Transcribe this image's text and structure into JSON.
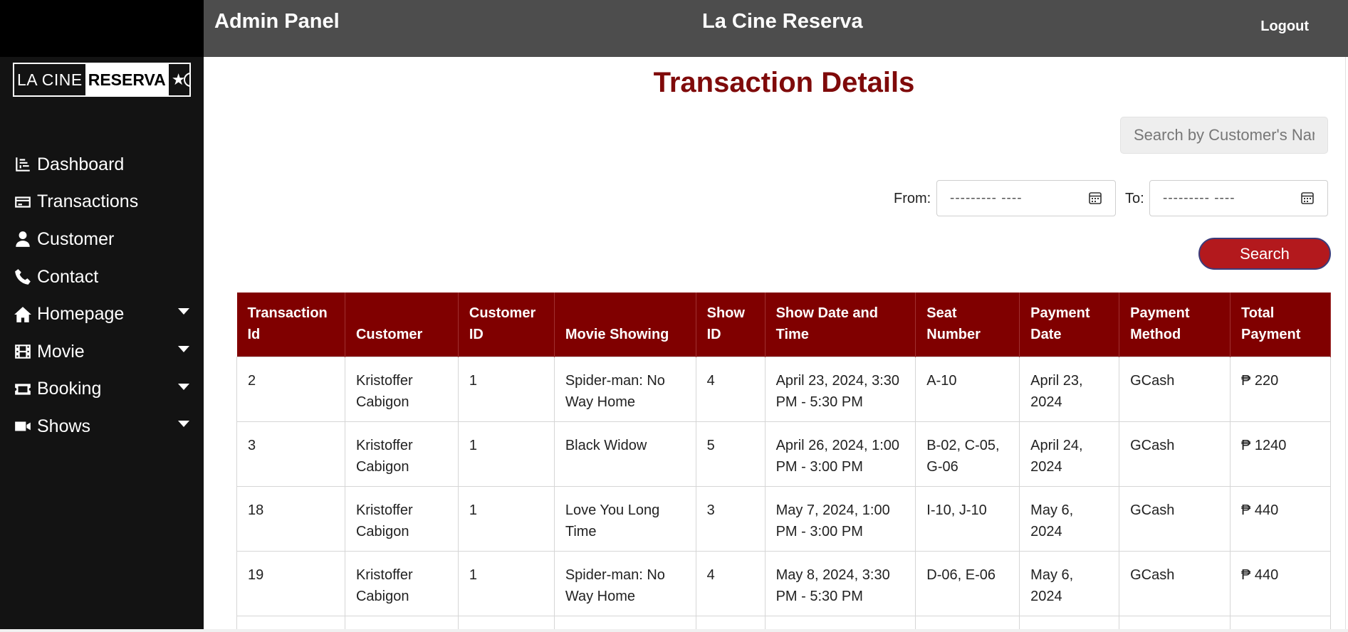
{
  "header": {
    "left_title": "Admin Panel",
    "center_title": "La Cine Reserva",
    "logout_label": "Logout"
  },
  "logo": {
    "light_text": "LA CINE",
    "dark_text": "RESERVA",
    "star": "★"
  },
  "sidebar": {
    "items": [
      {
        "label": "Dashboard",
        "icon": "chart-icon",
        "has_dropdown": false
      },
      {
        "label": "Transactions",
        "icon": "credit-card-icon",
        "has_dropdown": false
      },
      {
        "label": "Customer",
        "icon": "user-icon",
        "has_dropdown": false
      },
      {
        "label": "Contact",
        "icon": "phone-icon",
        "has_dropdown": false
      },
      {
        "label": "Homepage",
        "icon": "home-icon",
        "has_dropdown": true
      },
      {
        "label": "Movie",
        "icon": "film-icon",
        "has_dropdown": true
      },
      {
        "label": "Booking",
        "icon": "ticket-icon",
        "has_dropdown": true
      },
      {
        "label": "Shows",
        "icon": "video-camera-icon",
        "has_dropdown": true
      }
    ]
  },
  "main": {
    "title": "Transaction Details",
    "search_placeholder": "Search by Customer's Name",
    "from_label": "From:",
    "to_label": "To:",
    "date_placeholder": "--------- ----",
    "search_button": "Search"
  },
  "table": {
    "headers": [
      "Transaction Id",
      "Customer",
      "Customer ID",
      "Movie Showing",
      "Show ID",
      "Show Date and Time",
      "Seat Number",
      "Payment Date",
      "Payment Method",
      "Total Payment"
    ],
    "rows": [
      [
        "2",
        "Kristoffer Cabigon",
        "1",
        "Spider-man: No Way Home",
        "4",
        "April 23, 2024, 3:30 PM - 5:30 PM",
        "A-10",
        "April 23, 2024",
        "GCash",
        "₱ 220"
      ],
      [
        "3",
        "Kristoffer Cabigon",
        "1",
        "Black Widow",
        "5",
        "April 26, 2024, 1:00 PM - 3:00 PM",
        "B-02, C-05, G-06",
        "April 24, 2024",
        "GCash",
        "₱ 1240"
      ],
      [
        "18",
        "Kristoffer Cabigon",
        "1",
        "Love You Long Time",
        "3",
        "May 7, 2024, 1:00 PM - 3:00 PM",
        "I-10, J-10",
        "May 6, 2024",
        "GCash",
        "₱ 440"
      ],
      [
        "19",
        "Kristoffer Cabigon",
        "1",
        "Spider-man: No Way Home",
        "4",
        "May 8, 2024, 3:30 PM - 5:30 PM",
        "D-06, E-06",
        "May 6, 2024",
        "GCash",
        "₱ 440"
      ]
    ]
  },
  "colors": {
    "sidebar_bg": "#131313",
    "header_bg": "#4d4d4d",
    "title_color": "#7f0a0a",
    "table_header_bg": "#800000",
    "button_bg": "#b3191d"
  }
}
